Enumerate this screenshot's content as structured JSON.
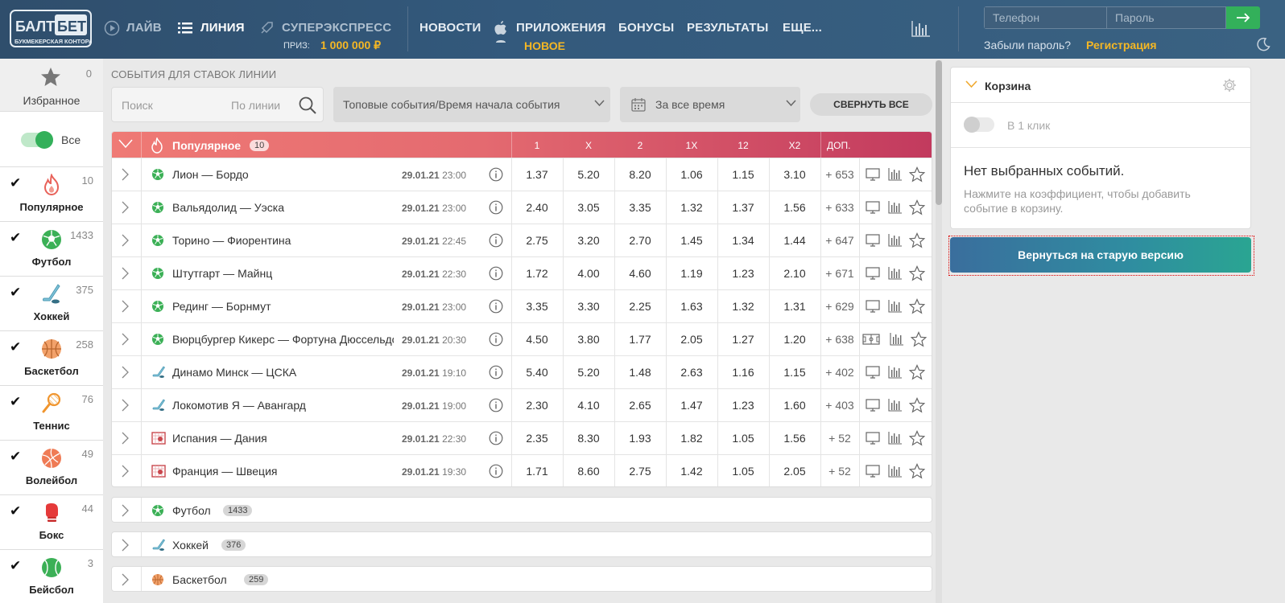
{
  "header": {
    "logo_text_top": "БАЛТ",
    "logo_text_bet": "БЕТ",
    "logo_subtitle": "БУКМЕКЕРСКАЯ КОНТОРА",
    "nav": {
      "live": "ЛАЙВ",
      "line": "ЛИНИЯ",
      "superexpress": "СУПЕРЭКСПРЕСС",
      "news": "НОВОСТИ",
      "apps": "ПРИЛОЖЕНИЯ",
      "bonuses": "БОНУСЫ",
      "results": "РЕЗУЛЬТАТЫ",
      "more": "ЕЩЕ..."
    },
    "prize_label": "ПРИЗ:",
    "prize_value": "1 000 000 ₽",
    "apps_badge": "НОВОЕ",
    "phone_placeholder": "Телефон",
    "password_placeholder": "Пароль",
    "forgot_password": "Забыли пароль?",
    "register": "Регистрация"
  },
  "sidebar": {
    "favorites_label": "Избранное",
    "favorites_count": "0",
    "all_label": "Все",
    "sports": [
      {
        "label": "Популярное",
        "count": "10",
        "icon": "fire-icon"
      },
      {
        "label": "Футбол",
        "count": "1433",
        "icon": "football-icon"
      },
      {
        "label": "Хоккей",
        "count": "375",
        "icon": "hockey-icon"
      },
      {
        "label": "Баскетбол",
        "count": "258",
        "icon": "basketball-icon"
      },
      {
        "label": "Теннис",
        "count": "76",
        "icon": "tennis-icon"
      },
      {
        "label": "Волейбол",
        "count": "49",
        "icon": "volleyball-icon"
      },
      {
        "label": "Бокс",
        "count": "44",
        "icon": "boxing-icon"
      },
      {
        "label": "Бейсбол",
        "count": "3",
        "icon": "baseball-icon"
      }
    ]
  },
  "main": {
    "title": "СОБЫТИЯ ДЛЯ СТАВОК ЛИНИИ",
    "search_placeholder": "Поиск",
    "search_mode": "По линии",
    "sort_select": "Топовые события/Время начала события",
    "period_select": "За все время",
    "collapse_all": "СВЕРНУТЬ ВСЕ",
    "popular": {
      "title": "Популярное",
      "count": "10",
      "columns": [
        "1",
        "X",
        "2",
        "1X",
        "12",
        "X2"
      ],
      "more_col": "ДОП."
    },
    "events": [
      {
        "sport": "football",
        "name": "Лион — Бордо",
        "date": "29.01.21",
        "time": "23:00",
        "odds": [
          "1.37",
          "5.20",
          "8.20",
          "1.06",
          "1.15",
          "3.10"
        ],
        "more": "+ 653"
      },
      {
        "sport": "football",
        "name": "Вальядолид — Уэска",
        "date": "29.01.21",
        "time": "23:00",
        "odds": [
          "2.40",
          "3.05",
          "3.35",
          "1.32",
          "1.37",
          "1.56"
        ],
        "more": "+ 633"
      },
      {
        "sport": "football",
        "name": "Торино — Фиорентина",
        "date": "29.01.21",
        "time": "22:45",
        "odds": [
          "2.75",
          "3.20",
          "2.70",
          "1.45",
          "1.34",
          "1.44"
        ],
        "more": "+ 647"
      },
      {
        "sport": "football",
        "name": "Штутгарт — Майнц",
        "date": "29.01.21",
        "time": "22:30",
        "odds": [
          "1.72",
          "4.00",
          "4.60",
          "1.19",
          "1.23",
          "2.10"
        ],
        "more": "+ 671"
      },
      {
        "sport": "football",
        "name": "Рединг — Борнмут",
        "date": "29.01.21",
        "time": "23:00",
        "odds": [
          "3.35",
          "3.30",
          "2.25",
          "1.63",
          "1.32",
          "1.31"
        ],
        "more": "+ 629"
      },
      {
        "sport": "football",
        "name": "Вюрцбургер Кикерс — Фортуна Дюссельдорф",
        "date": "29.01.21",
        "time": "20:30",
        "odds": [
          "4.50",
          "3.80",
          "1.77",
          "2.05",
          "1.27",
          "1.20"
        ],
        "more": "+ 638"
      },
      {
        "sport": "hockey",
        "name": "Динамо Минск — ЦСКА",
        "date": "29.01.21",
        "time": "19:10",
        "odds": [
          "5.40",
          "5.20",
          "1.48",
          "2.63",
          "1.16",
          "1.15"
        ],
        "more": "+ 402"
      },
      {
        "sport": "hockey",
        "name": "Локомотив Я — Авангард",
        "date": "29.01.21",
        "time": "19:00",
        "odds": [
          "2.30",
          "4.10",
          "2.65",
          "1.47",
          "1.23",
          "1.60"
        ],
        "more": "+ 403"
      },
      {
        "sport": "handball",
        "name": "Испания — Дания",
        "date": "29.01.21",
        "time": "22:30",
        "odds": [
          "2.35",
          "8.30",
          "1.93",
          "1.82",
          "1.05",
          "1.56"
        ],
        "more": "+ 52"
      },
      {
        "sport": "handball",
        "name": "Франция — Швеция",
        "date": "29.01.21",
        "time": "19:30",
        "odds": [
          "1.71",
          "8.60",
          "2.75",
          "1.42",
          "1.05",
          "2.05"
        ],
        "more": "+ 52"
      }
    ],
    "groups": [
      {
        "name": "Футбол",
        "count": "1433",
        "icon": "football-icon"
      },
      {
        "name": "Хоккей",
        "count": "376",
        "icon": "hockey-icon"
      },
      {
        "name": "Баскетбол",
        "count": "259",
        "icon": "basketball-icon"
      }
    ]
  },
  "basket": {
    "title": "Корзина",
    "one_click": "В 1 клик",
    "empty_title": "Нет выбранных событий.",
    "empty_hint": "Нажмите на коэффициент, чтобы добавить событие в корзину.",
    "old_version_button": "Вернуться на старую версию"
  },
  "colors": {
    "header_bg": "#33597c",
    "accent_yellow": "#f5b724",
    "accent_green": "#33b05a",
    "popular_gradient_start": "#ef7a75",
    "popular_gradient_end": "#c23a5e"
  }
}
